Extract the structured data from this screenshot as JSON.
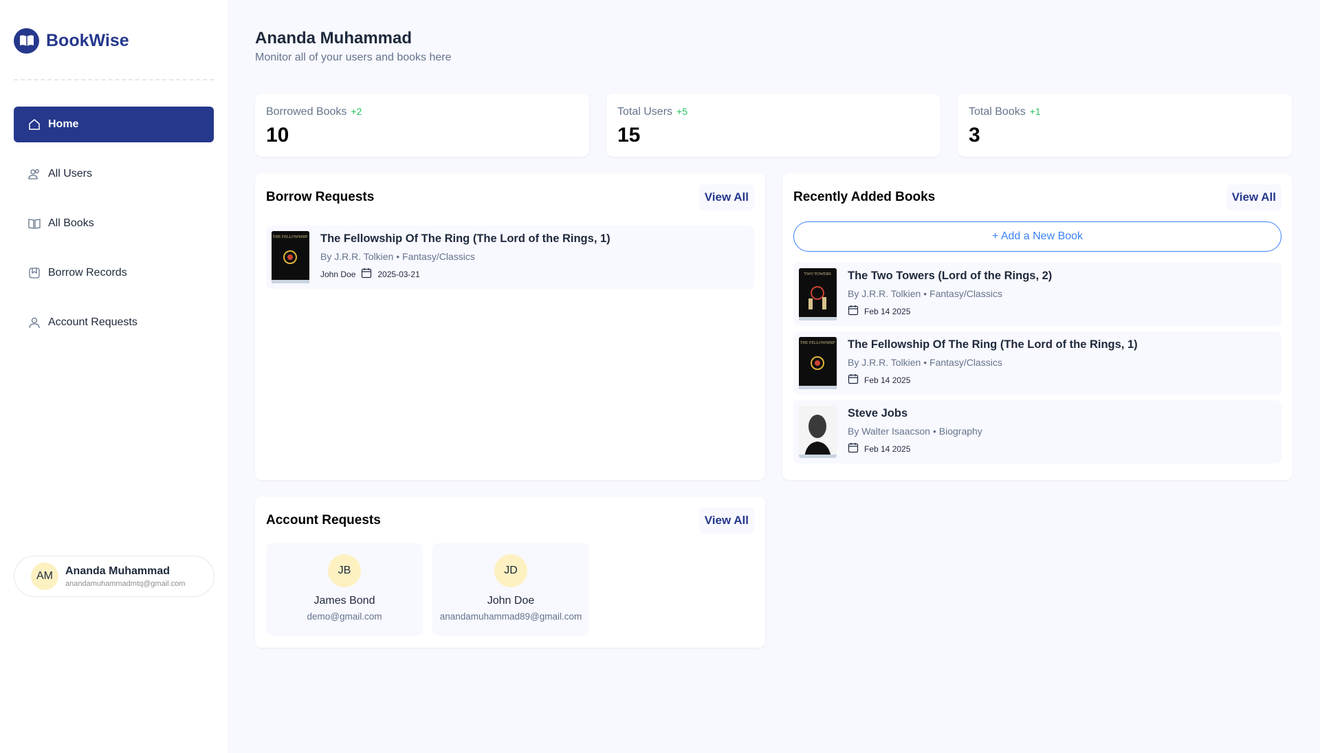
{
  "brand": {
    "name": "BookWise"
  },
  "nav": [
    {
      "label": "Home",
      "icon": "home-icon",
      "active": true
    },
    {
      "label": "All Users",
      "icon": "users-icon"
    },
    {
      "label": "All Books",
      "icon": "book-icon"
    },
    {
      "label": "Borrow Records",
      "icon": "bookmark-icon"
    },
    {
      "label": "Account Requests",
      "icon": "user-icon"
    }
  ],
  "current_user": {
    "initials": "AM",
    "name": "Ananda Muhammad",
    "email": "anandamuhammadmtq@gmail.com"
  },
  "header": {
    "title": "Ananda Muhammad",
    "subtitle": "Monitor all of your users and books here"
  },
  "stats": [
    {
      "label": "Borrowed Books",
      "change": "+2",
      "value": "10"
    },
    {
      "label": "Total Users",
      "change": "+5",
      "value": "15"
    },
    {
      "label": "Total Books",
      "change": "+1",
      "value": "3"
    }
  ],
  "borrow_requests": {
    "title": "Borrow Requests",
    "view_all": "View All",
    "items": [
      {
        "title": "The Fellowship Of The Ring (The Lord of the Rings, 1)",
        "meta": "By J.R.R. Tolkien • Fantasy/Classics",
        "user": "John Doe",
        "date": "2025-03-21"
      }
    ]
  },
  "recent_books": {
    "title": "Recently Added Books",
    "view_all": "View All",
    "add_label": "+ Add a New Book",
    "items": [
      {
        "title": "The Two Towers (Lord of the Rings, 2)",
        "meta": "By J.R.R. Tolkien • Fantasy/Classics",
        "date": "Feb 14 2025"
      },
      {
        "title": "The Fellowship Of The Ring (The Lord of the Rings, 1)",
        "meta": "By J.R.R. Tolkien • Fantasy/Classics",
        "date": "Feb 14 2025"
      },
      {
        "title": "Steve Jobs",
        "meta": "By Walter Isaacson • Biography",
        "date": "Feb 14 2025"
      }
    ]
  },
  "account_requests": {
    "title": "Account Requests",
    "view_all": "View All",
    "items": [
      {
        "initials": "JB",
        "name": "James Bond",
        "email": "demo@gmail.com"
      },
      {
        "initials": "JD",
        "name": "John Doe",
        "email": "anandamuhammad89@gmail.com"
      }
    ]
  },
  "colors": {
    "primary": "#25388c",
    "accent_green": "#22c55e",
    "link_blue": "#3b82f6",
    "avatar_bg": "#fdf1c2"
  }
}
